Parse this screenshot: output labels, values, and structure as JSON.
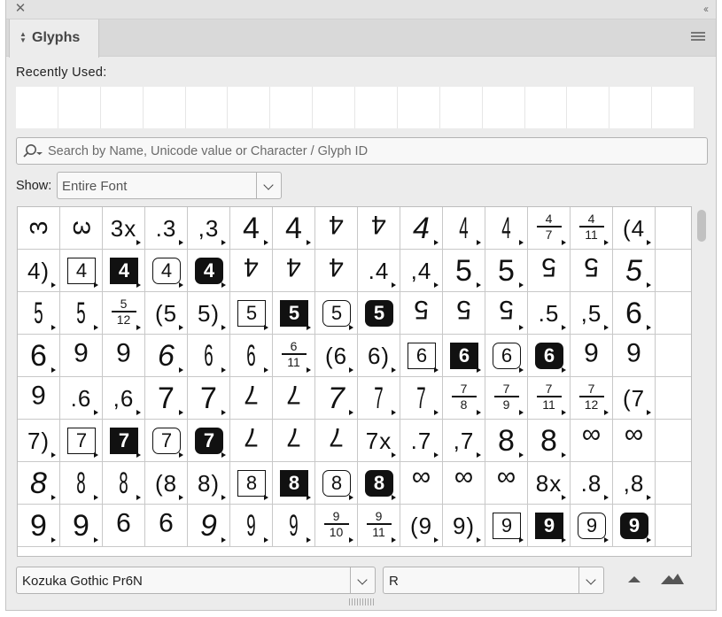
{
  "panel": {
    "title": "Glyphs",
    "close_icon": "close-icon",
    "collapse_icon": "collapse-icon",
    "menu_icon": "panel-menu-icon"
  },
  "recent": {
    "label": "Recently Used:",
    "slots": 16
  },
  "search": {
    "placeholder": "Search by Name, Unicode value or Character / Glyph ID"
  },
  "show": {
    "label": "Show:",
    "value": "Entire Font"
  },
  "grid": {
    "cells": [
      {
        "t": "3",
        "c": "g flat2"
      },
      {
        "t": "3",
        "c": "g flat"
      },
      {
        "t": "3x",
        "c": "g s"
      },
      {
        "t": ".3",
        "c": "g s"
      },
      {
        "t": ",3",
        "c": "g s"
      },
      {
        "t": "4",
        "c": "g"
      },
      {
        "t": "4",
        "c": "g"
      },
      {
        "t": "4",
        "c": "g hi rot"
      },
      {
        "t": "4",
        "c": "g hi rot"
      },
      {
        "t": "4",
        "c": "g it"
      },
      {
        "t": "4",
        "c": "g thin"
      },
      {
        "t": "4",
        "c": "g thin"
      },
      {
        "f": [
          "4",
          "7"
        ]
      },
      {
        "f": [
          "4",
          "11"
        ]
      },
      {
        "t": "(4",
        "c": "g s"
      },
      {
        "t": "",
        "c": "g"
      },
      {
        "t": "4)",
        "c": "g s"
      },
      {
        "b": "4",
        "k": "sq"
      },
      {
        "b": "4",
        "k": "sq-inv"
      },
      {
        "b": "4",
        "k": "rnd"
      },
      {
        "b": "4",
        "k": "rnd-inv"
      },
      {
        "t": "4",
        "c": "g hi rot"
      },
      {
        "t": "4",
        "c": "g hi rot"
      },
      {
        "t": "4",
        "c": "g hi rot"
      },
      {
        "t": ".4",
        "c": "g s"
      },
      {
        "t": ",4",
        "c": "g s"
      },
      {
        "t": "5",
        "c": "g"
      },
      {
        "t": "5",
        "c": "g"
      },
      {
        "t": "5",
        "c": "g hi rot"
      },
      {
        "t": "5",
        "c": "g hi rot"
      },
      {
        "t": "5",
        "c": "g it"
      },
      {
        "t": "",
        "c": "g"
      },
      {
        "t": "5",
        "c": "g thin"
      },
      {
        "t": "5",
        "c": "g thin"
      },
      {
        "f": [
          "5",
          "12"
        ]
      },
      {
        "t": "(5",
        "c": "g s"
      },
      {
        "t": "5)",
        "c": "g s"
      },
      {
        "b": "5",
        "k": "sq"
      },
      {
        "b": "5",
        "k": "sq-inv"
      },
      {
        "b": "5",
        "k": "rnd"
      },
      {
        "b": "5",
        "k": "rnd-inv"
      },
      {
        "t": "5",
        "c": "g hi rot"
      },
      {
        "t": "5",
        "c": "g hi rot"
      },
      {
        "t": "5",
        "c": "g hi rot"
      },
      {
        "t": ".5",
        "c": "g s"
      },
      {
        "t": ",5",
        "c": "g s"
      },
      {
        "t": "6",
        "c": "g"
      },
      {
        "t": "",
        "c": "g"
      },
      {
        "t": "6",
        "c": "g"
      },
      {
        "t": "6",
        "c": "g hi rot"
      },
      {
        "t": "6",
        "c": "g hi rot"
      },
      {
        "t": "6",
        "c": "g it"
      },
      {
        "t": "6",
        "c": "g thin"
      },
      {
        "t": "6",
        "c": "g thin"
      },
      {
        "f": [
          "6",
          "11"
        ]
      },
      {
        "t": "(6",
        "c": "g s"
      },
      {
        "t": "6)",
        "c": "g s"
      },
      {
        "b": "6",
        "k": "sq"
      },
      {
        "b": "6",
        "k": "sq-inv"
      },
      {
        "b": "6",
        "k": "rnd"
      },
      {
        "b": "6",
        "k": "rnd-inv"
      },
      {
        "t": "6",
        "c": "g hi rot"
      },
      {
        "t": "6",
        "c": "g hi rot"
      },
      {
        "t": "",
        "c": "g"
      },
      {
        "t": "6",
        "c": "g hi rot"
      },
      {
        "t": ".6",
        "c": "g s"
      },
      {
        "t": ",6",
        "c": "g s"
      },
      {
        "t": "7",
        "c": "g"
      },
      {
        "t": "7",
        "c": "g"
      },
      {
        "t": "7",
        "c": "g hi rot"
      },
      {
        "t": "7",
        "c": "g hi rot"
      },
      {
        "t": "7",
        "c": "g it"
      },
      {
        "t": "7",
        "c": "g thin"
      },
      {
        "t": "7",
        "c": "g thin"
      },
      {
        "f": [
          "7",
          "8"
        ]
      },
      {
        "f": [
          "7",
          "9"
        ]
      },
      {
        "f": [
          "7",
          "11"
        ]
      },
      {
        "f": [
          "7",
          "12"
        ]
      },
      {
        "t": "(7",
        "c": "g s"
      },
      {
        "t": "",
        "c": "g"
      },
      {
        "t": "7)",
        "c": "g s"
      },
      {
        "b": "7",
        "k": "sq"
      },
      {
        "b": "7",
        "k": "sq-inv"
      },
      {
        "b": "7",
        "k": "rnd"
      },
      {
        "b": "7",
        "k": "rnd-inv"
      },
      {
        "t": "7",
        "c": "g hi rot"
      },
      {
        "t": "7",
        "c": "g hi rot"
      },
      {
        "t": "7",
        "c": "g hi rot"
      },
      {
        "t": "7x",
        "c": "g s"
      },
      {
        "t": ".7",
        "c": "g s"
      },
      {
        "t": ",7",
        "c": "g s"
      },
      {
        "t": "8",
        "c": "g"
      },
      {
        "t": "8",
        "c": "g"
      },
      {
        "t": "∞",
        "c": "g hi"
      },
      {
        "t": "∞",
        "c": "g hi"
      },
      {
        "t": "",
        "c": "g"
      },
      {
        "t": "8",
        "c": "g it"
      },
      {
        "t": "8",
        "c": "g thin"
      },
      {
        "t": "8",
        "c": "g thin"
      },
      {
        "t": "(8",
        "c": "g s"
      },
      {
        "t": "8)",
        "c": "g s"
      },
      {
        "b": "8",
        "k": "sq"
      },
      {
        "b": "8",
        "k": "sq-inv"
      },
      {
        "b": "8",
        "k": "rnd"
      },
      {
        "b": "8",
        "k": "rnd-inv"
      },
      {
        "t": "∞",
        "c": "g hi"
      },
      {
        "t": "∞",
        "c": "g hi"
      },
      {
        "t": "∞",
        "c": "g hi"
      },
      {
        "t": "8x",
        "c": "g s"
      },
      {
        "t": ".8",
        "c": "g s"
      },
      {
        "t": ",8",
        "c": "g s"
      },
      {
        "t": "",
        "c": "g"
      },
      {
        "t": "9",
        "c": "g"
      },
      {
        "t": "9",
        "c": "g"
      },
      {
        "t": "9",
        "c": "g hi rot"
      },
      {
        "t": "9",
        "c": "g hi rot"
      },
      {
        "t": "9",
        "c": "g it"
      },
      {
        "t": "9",
        "c": "g thin"
      },
      {
        "t": "9",
        "c": "g thin"
      },
      {
        "f": [
          "9",
          "10"
        ]
      },
      {
        "f": [
          "9",
          "11"
        ]
      },
      {
        "t": "(9",
        "c": "g s"
      },
      {
        "t": "9)",
        "c": "g s"
      },
      {
        "b": "9",
        "k": "sq"
      },
      {
        "b": "9",
        "k": "sq-inv"
      },
      {
        "b": "9",
        "k": "rnd"
      },
      {
        "b": "9",
        "k": "rnd-inv"
      },
      {
        "t": "",
        "c": "g"
      }
    ],
    "no_triangle": [
      0,
      1,
      7,
      8,
      21,
      22,
      23,
      28,
      29,
      40,
      41,
      42,
      49,
      50,
      61,
      62,
      64,
      69,
      70,
      85,
      86,
      87,
      93,
      94,
      105,
      106,
      107,
      114,
      115
    ]
  },
  "footer": {
    "font_family": "Kozuka Gothic Pr6N",
    "font_style": "R",
    "zoom_out_icon": "zoom-out-icon",
    "zoom_in_icon": "zoom-in-icon"
  }
}
